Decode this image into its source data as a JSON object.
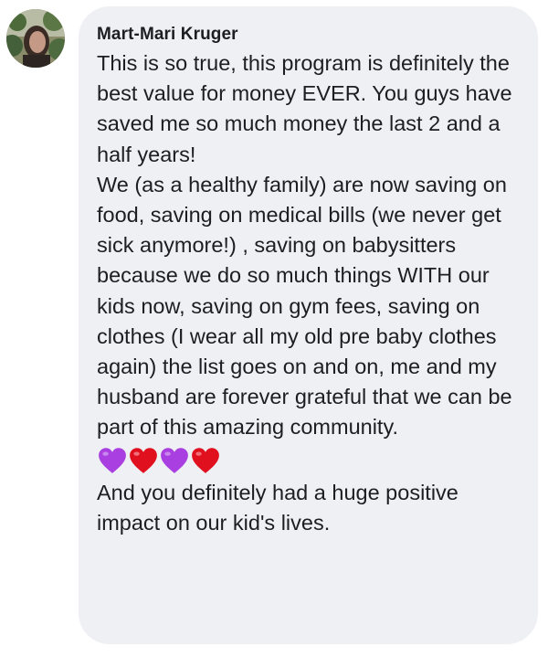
{
  "comment": {
    "author": "Mart-Mari Kruger",
    "avatar_icon": "profile-photo",
    "paragraphs": [
      "This is so true, this program is definitely the best value for money EVER. You guys have saved me so much money the last 2 and a half years!",
      "We (as a healthy family) are now saving on food, saving on medical bills (we never get sick anymore!) , saving on babysitters because we do so much things WITH our kids now, saving on gym fees, saving on clothes (I wear all my old pre baby clothes again) the list goes on and on, me and my husband are forever grateful that we can be part of this amazing community."
    ],
    "emoji": [
      "purple-heart",
      "red-heart",
      "purple-heart",
      "red-heart"
    ],
    "closing": "And you definitely had a huge positive impact on our kid's lives."
  },
  "colors": {
    "bubble_background": "#eff0f4",
    "text": "#1c1e21",
    "purple_heart": "#a93fe0",
    "red_heart": "#e0101e"
  }
}
